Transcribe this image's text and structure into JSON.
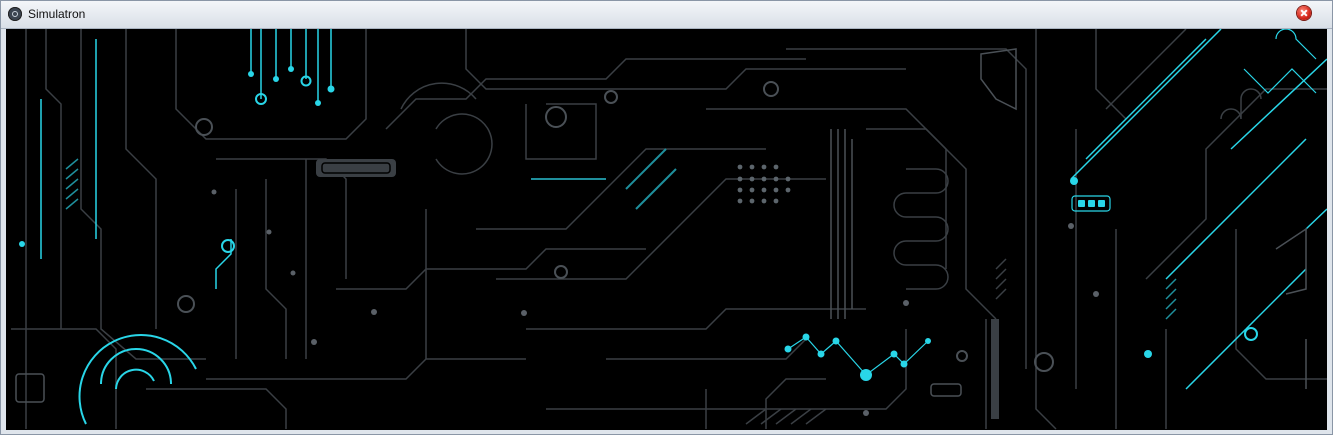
{
  "window": {
    "title": "Simulatron",
    "icon": "app-icon",
    "close_icon": "close-icon"
  },
  "canvas": {
    "icon": "circuit-board-art",
    "colors": {
      "background": "#000000",
      "trace": "#3a3f44",
      "accent": "#29d6e8",
      "accent_dim": "#1f8f9c"
    }
  }
}
